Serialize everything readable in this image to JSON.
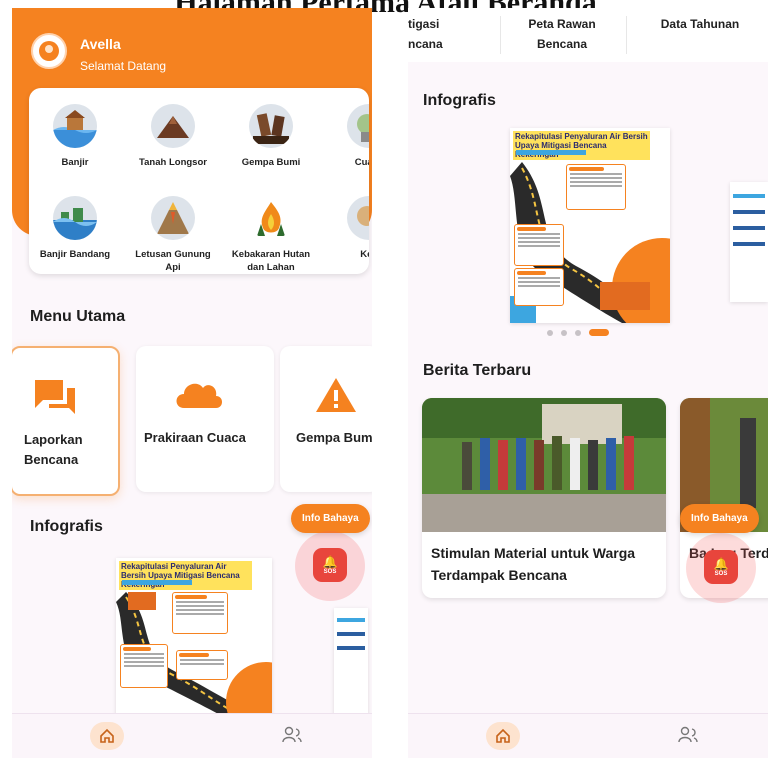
{
  "caption": "Halaman Pertama Atau Beranda",
  "left": {
    "user": {
      "name": "Avella",
      "greeting": "Selamat Datang"
    },
    "categories": [
      {
        "label": "Banjir",
        "icon": "flood-icon"
      },
      {
        "label": "Tanah Longsor",
        "icon": "landslide-icon"
      },
      {
        "label": "Gempa Bumi",
        "icon": "earthquake-icon"
      },
      {
        "label": "Cuaca",
        "icon": "weather-icon"
      },
      {
        "label": "Banjir Bandang",
        "icon": "flash-flood-icon"
      },
      {
        "label": "Letusan Gunung Api",
        "icon": "volcano-icon"
      },
      {
        "label": "Kebakaran Hutan dan Lahan",
        "icon": "forest-fire-icon"
      },
      {
        "label": "Kek",
        "icon": "drought-icon"
      }
    ],
    "menu_title": "Menu Utama",
    "menu": [
      {
        "label": "Laporkan Bencana",
        "icon": "chat-icon"
      },
      {
        "label": "Prakiraan Cuaca",
        "icon": "cloud-icon"
      },
      {
        "label": "Gempa Bumi",
        "icon": "warning-icon"
      }
    ],
    "infografis_title": "Infografis",
    "info_bahaya": "Info Bahaya",
    "sos": "SOS"
  },
  "right": {
    "tabs": [
      "tigasi\nncana",
      "Peta Rawan\nBencana",
      "Data Tahunan"
    ],
    "infografis_title": "Infografis",
    "carousel": {
      "count": 4,
      "active": 4
    },
    "news_title": "Berita Terbaru",
    "news": [
      {
        "title": "Stimulan Material untuk Warga Terdampak Bencana"
      },
      {
        "title": "Ba   Log Terdampak"
      }
    ],
    "info_bahaya": "Info Bahaya",
    "sos": "SOS"
  },
  "infographic_text": "Rekapitulasi Penyaluran Air Bersih Upaya Mitigasi Bencana Kekeringan",
  "colors": {
    "primary": "#f58220",
    "sos": "#e8453c",
    "background": "#fcf7fb"
  }
}
